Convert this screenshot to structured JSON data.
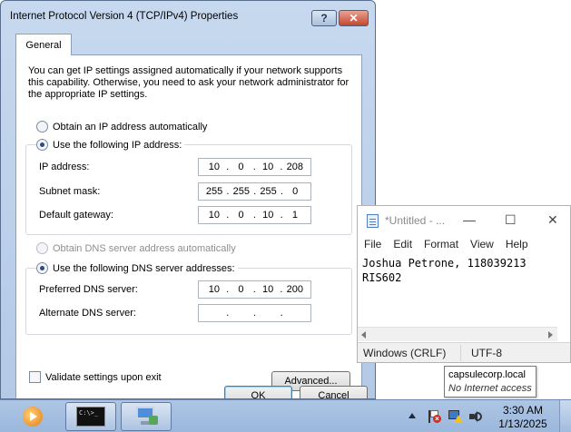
{
  "dialog": {
    "title": "Internet Protocol Version 4 (TCP/IPv4) Properties",
    "help_label": "?",
    "close_label": "✕",
    "tab": "General",
    "intro": "You can get IP settings assigned automatically if your network supports this capability. Otherwise, you need to ask your network administrator for the appropriate IP settings.",
    "ip_auto_label": "Obtain an IP address automatically",
    "ip_manual_label": "Use the following IP address:",
    "ip_manual_selected": true,
    "fields": {
      "ip_label": "IP address:",
      "ip": [
        "10",
        "0",
        "10",
        "208"
      ],
      "mask_label": "Subnet mask:",
      "mask": [
        "255",
        "255",
        "255",
        "0"
      ],
      "gateway_label": "Default gateway:",
      "gateway": [
        "10",
        "0",
        "10",
        "1"
      ]
    },
    "dns_auto_label": "Obtain DNS server address automatically",
    "dns_manual_label": "Use the following DNS server addresses:",
    "dns": {
      "preferred_label": "Preferred DNS server:",
      "preferred": [
        "10",
        "0",
        "10",
        "200"
      ],
      "alternate_label": "Alternate DNS server:",
      "alternate": [
        "",
        "",
        "",
        ""
      ]
    },
    "validate_label": "Validate settings upon exit",
    "advanced_label": "Advanced...",
    "ok_label": "OK",
    "cancel_label": "Cancel"
  },
  "notepad": {
    "title": "*Untitled - ...",
    "menu": [
      "File",
      "Edit",
      "Format",
      "View",
      "Help"
    ],
    "text_line1": "Joshua Petrone, 118039213",
    "text_line2": "RIS602",
    "status_eol": "Windows (CRLF)",
    "status_encoding": "UTF-8",
    "minimize_glyph": "—",
    "maximize_glyph": "☐",
    "close_glyph": "✕"
  },
  "tooltip": {
    "network": "capsulecorp.local",
    "status": "No Internet access"
  },
  "taskbar": {
    "cmd_text": "C:\\>_",
    "time": "3:30 AM",
    "date": "1/13/2025",
    "icons": [
      "media-player-icon",
      "command-prompt-icon",
      "network-connections-icon"
    ]
  },
  "colors": {
    "dialog_frame": "#b3c9e6",
    "close_button": "#c6452d",
    "taskbar": "#9bb7dc"
  }
}
